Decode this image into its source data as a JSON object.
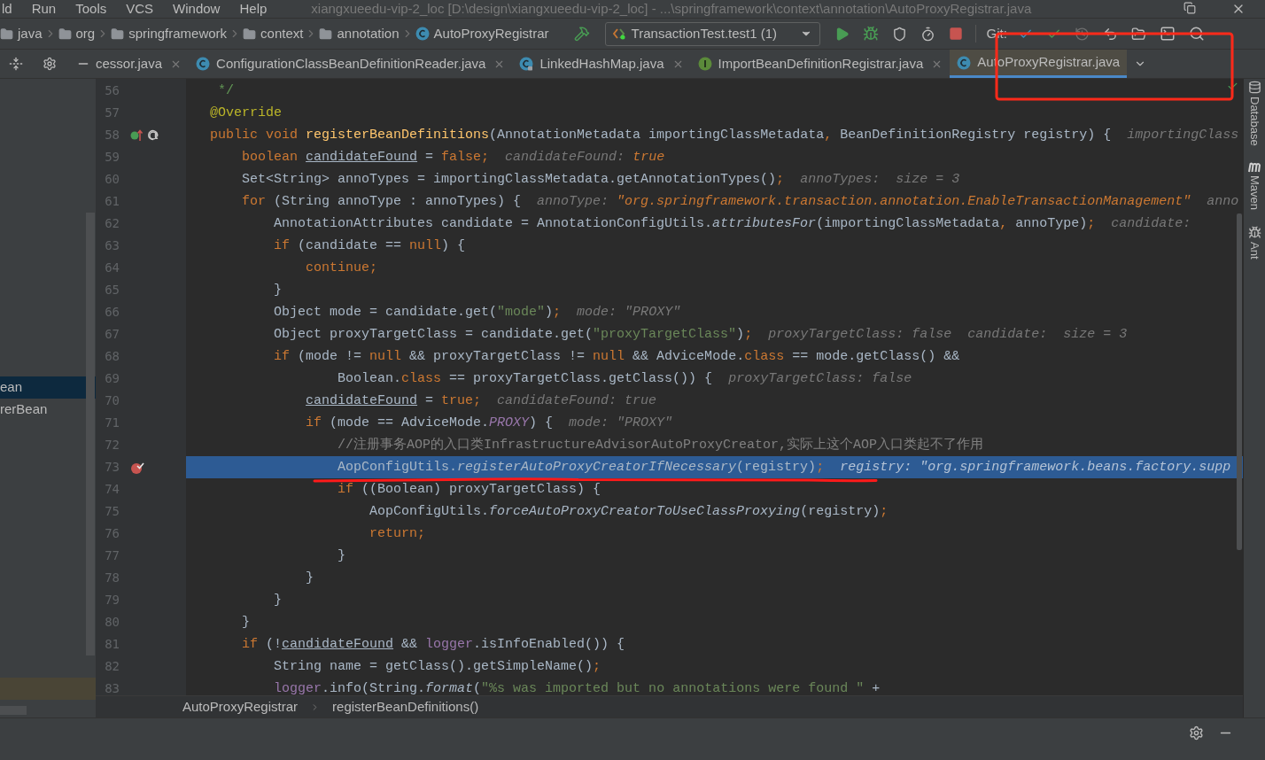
{
  "menu_bar": {
    "items": [
      "ld",
      "Run",
      "Tools",
      "VCS",
      "Window",
      "Help"
    ],
    "title": "xiangxueedu-vip-2_loc [D:\\design\\xiangxueedu-vip-2_loc] - ...\\springframework\\context\\annotation\\AutoProxyRegistrar.java"
  },
  "navigation_bar": {
    "breadcrumbs": [
      {
        "kind": "folder",
        "label": "java"
      },
      {
        "kind": "folder",
        "label": "org"
      },
      {
        "kind": "folder",
        "label": "springframework"
      },
      {
        "kind": "folder",
        "label": "context"
      },
      {
        "kind": "folder",
        "label": "annotation"
      },
      {
        "kind": "class",
        "label": "AutoProxyRegistrar"
      }
    ],
    "run_configuration": "TransactionTest.test1 (1)",
    "vcs_label": "Git:"
  },
  "project_panel": {
    "items": [
      {
        "label": "ean",
        "selected": true
      },
      {
        "label": "rerBean",
        "selected": false
      }
    ]
  },
  "tabs": [
    {
      "kind": "plain",
      "label": "cessor.java",
      "selected": false,
      "closable": true
    },
    {
      "kind": "class",
      "label": "ConfigurationClassBeanDefinitionReader.java",
      "selected": false,
      "closable": true
    },
    {
      "kind": "locked-class",
      "label": "LinkedHashMap.java",
      "selected": false,
      "closable": true
    },
    {
      "kind": "interface",
      "label": "ImportBeanDefinitionRegistrar.java",
      "selected": false,
      "closable": true
    },
    {
      "kind": "class",
      "label": "AutoProxyRegistrar.java",
      "selected": true,
      "closable": false
    }
  ],
  "editor": {
    "lines": [
      {
        "number": "56",
        "current": false,
        "tokens": [
          {
            "kind": "doc",
            "text": " */"
          }
        ]
      },
      {
        "number": "57",
        "current": false,
        "tokens": [
          {
            "kind": "annotation",
            "text": "@Override"
          }
        ]
      },
      {
        "number": "58",
        "current": false,
        "gutter_icons": [
          {
            "kind": "implements"
          }
        ],
        "tokens": [
          {
            "kind": "keyword",
            "text": "public void "
          },
          {
            "kind": "declaration",
            "text": "registerBeanDefinitions"
          },
          {
            "kind": "plain",
            "text": "(AnnotationMetadata importingClassMetadata"
          },
          {
            "kind": "keyword",
            "text": ","
          },
          {
            "kind": "plain",
            "text": " BeanDefinitionRegistry registry) {"
          },
          {
            "kind": "hint",
            "text": "  importingClass"
          }
        ]
      },
      {
        "number": "59",
        "current": false,
        "tokens": [
          {
            "kind": "keyword",
            "text": "    boolean "
          },
          {
            "kind": "underlined",
            "text": "candidateFound"
          },
          {
            "kind": "plain",
            "text": " = "
          },
          {
            "kind": "keyword",
            "text": "false;"
          },
          {
            "kind": "hint",
            "text": "  candidateFound: "
          },
          {
            "kind": "hint-value",
            "text": "true"
          }
        ]
      },
      {
        "number": "60",
        "current": false,
        "tokens": [
          {
            "kind": "plain",
            "text": "    Set<String> annoTypes = importingClassMetadata.getAnnotationTypes()"
          },
          {
            "kind": "keyword",
            "text": ";"
          },
          {
            "kind": "hint",
            "text": "  annoTypes:  size = 3"
          }
        ]
      },
      {
        "number": "61",
        "current": false,
        "tokens": [
          {
            "kind": "keyword",
            "text": "    for"
          },
          {
            "kind": "plain",
            "text": " (String annoType : annoTypes) {"
          },
          {
            "kind": "hint",
            "text": "  annoType: "
          },
          {
            "kind": "hint-value",
            "text": "\"org.springframework.transaction.annotation.EnableTransactionManagement\""
          },
          {
            "kind": "hint",
            "text": "  anno"
          }
        ]
      },
      {
        "number": "62",
        "current": false,
        "tokens": [
          {
            "kind": "plain",
            "text": "        AnnotationAttributes candidate = AnnotationConfigUtils."
          },
          {
            "kind": "italic",
            "text": "attributesFor"
          },
          {
            "kind": "plain",
            "text": "(importingClassMetadata"
          },
          {
            "kind": "keyword",
            "text": ","
          },
          {
            "kind": "plain",
            "text": " annoType)"
          },
          {
            "kind": "keyword",
            "text": ";"
          },
          {
            "kind": "hint",
            "text": "  candidate:"
          }
        ]
      },
      {
        "number": "63",
        "current": false,
        "tokens": [
          {
            "kind": "keyword",
            "text": "        if"
          },
          {
            "kind": "plain",
            "text": " (candidate == "
          },
          {
            "kind": "keyword",
            "text": "null"
          },
          {
            "kind": "plain",
            "text": ") {"
          }
        ]
      },
      {
        "number": "64",
        "current": false,
        "tokens": [
          {
            "kind": "keyword",
            "text": "            continue;"
          }
        ]
      },
      {
        "number": "65",
        "current": false,
        "tokens": [
          {
            "kind": "plain",
            "text": "        }"
          }
        ]
      },
      {
        "number": "66",
        "current": false,
        "tokens": [
          {
            "kind": "plain",
            "text": "        Object mode = candidate.get("
          },
          {
            "kind": "string",
            "text": "\"mode\""
          },
          {
            "kind": "plain",
            "text": ")"
          },
          {
            "kind": "keyword",
            "text": ";"
          },
          {
            "kind": "hint",
            "text": "  mode: \"PROXY\""
          }
        ]
      },
      {
        "number": "67",
        "current": false,
        "tokens": [
          {
            "kind": "plain",
            "text": "        Object proxyTargetClass = candidate.get("
          },
          {
            "kind": "string",
            "text": "\"proxyTargetClass\""
          },
          {
            "kind": "plain",
            "text": ")"
          },
          {
            "kind": "keyword",
            "text": ";"
          },
          {
            "kind": "hint",
            "text": "  proxyTargetClass: false  candidate:  size = 3"
          }
        ]
      },
      {
        "number": "68",
        "current": false,
        "tokens": [
          {
            "kind": "keyword",
            "text": "        if"
          },
          {
            "kind": "plain",
            "text": " (mode != "
          },
          {
            "kind": "keyword",
            "text": "null"
          },
          {
            "kind": "plain",
            "text": " && proxyTargetClass != "
          },
          {
            "kind": "keyword",
            "text": "null"
          },
          {
            "kind": "plain",
            "text": " && AdviceMode."
          },
          {
            "kind": "keyword",
            "text": "class"
          },
          {
            "kind": "plain",
            "text": " == mode.getClass() &&"
          }
        ]
      },
      {
        "number": "69",
        "current": false,
        "tokens": [
          {
            "kind": "plain",
            "text": "                Boolean."
          },
          {
            "kind": "keyword",
            "text": "class"
          },
          {
            "kind": "plain",
            "text": " == proxyTargetClass.getClass()) {"
          },
          {
            "kind": "hint",
            "text": "  proxyTargetClass: false"
          }
        ]
      },
      {
        "number": "70",
        "current": false,
        "tokens": [
          {
            "kind": "underlined",
            "text": "            candidateFound"
          },
          {
            "kind": "plain",
            "text": " = "
          },
          {
            "kind": "keyword",
            "text": "true;"
          },
          {
            "kind": "hint",
            "text": "  candidateFound: true"
          }
        ]
      },
      {
        "number": "71",
        "current": false,
        "tokens": [
          {
            "kind": "keyword",
            "text": "            if"
          },
          {
            "kind": "plain",
            "text": " (mode == AdviceMode."
          },
          {
            "kind": "constant",
            "text": "PROXY"
          },
          {
            "kind": "plain",
            "text": ") {"
          },
          {
            "kind": "hint",
            "text": "  mode: \"PROXY\""
          }
        ]
      },
      {
        "number": "72",
        "current": false,
        "tokens": [
          {
            "kind": "comment",
            "text": "                //注册事务AOP的入口类InfrastructureAdvisorAutoProxyCreator,实际上这个AOP入口类起不了作用"
          }
        ]
      },
      {
        "number": "73",
        "current": true,
        "gutter_icons": [
          {
            "kind": "breakpoint"
          }
        ],
        "tokens": [
          {
            "kind": "plain",
            "text": "                AopConfigUtils."
          },
          {
            "kind": "italic",
            "text": "registerAutoProxyCreatorIfNecessary"
          },
          {
            "kind": "plain",
            "text": "(registry)"
          },
          {
            "kind": "keyword",
            "text": ";"
          },
          {
            "kind": "hint",
            "text": "  registry: \"org.springframework.beans.factory.supp"
          }
        ]
      },
      {
        "number": "74",
        "current": false,
        "tokens": [
          {
            "kind": "keyword",
            "text": "                if"
          },
          {
            "kind": "plain",
            "text": " ((Boolean) proxyTargetClass) {"
          }
        ]
      },
      {
        "number": "75",
        "current": false,
        "tokens": [
          {
            "kind": "plain",
            "text": "                    AopConfigUtils."
          },
          {
            "kind": "italic",
            "text": "forceAutoProxyCreatorToUseClassProxying"
          },
          {
            "kind": "plain",
            "text": "(registry)"
          },
          {
            "kind": "keyword",
            "text": ";"
          }
        ]
      },
      {
        "number": "76",
        "current": false,
        "tokens": [
          {
            "kind": "keyword",
            "text": "                    return;"
          }
        ]
      },
      {
        "number": "77",
        "current": false,
        "tokens": [
          {
            "kind": "plain",
            "text": "                }"
          }
        ]
      },
      {
        "number": "78",
        "current": false,
        "tokens": [
          {
            "kind": "plain",
            "text": "            }"
          }
        ]
      },
      {
        "number": "79",
        "current": false,
        "tokens": [
          {
            "kind": "plain",
            "text": "        }"
          }
        ]
      },
      {
        "number": "80",
        "current": false,
        "tokens": [
          {
            "kind": "plain",
            "text": "    }"
          }
        ]
      },
      {
        "number": "81",
        "current": false,
        "tokens": [
          {
            "kind": "keyword",
            "text": "    if"
          },
          {
            "kind": "plain",
            "text": " (!"
          },
          {
            "kind": "underlined",
            "text": "candidateFound"
          },
          {
            "kind": "plain",
            "text": " && "
          },
          {
            "kind": "field",
            "text": "logger"
          },
          {
            "kind": "plain",
            "text": ".isInfoEnabled()) {"
          }
        ]
      },
      {
        "number": "82",
        "current": false,
        "tokens": [
          {
            "kind": "plain",
            "text": "        String name = getClass().getSimpleName()"
          },
          {
            "kind": "keyword",
            "text": ";"
          }
        ]
      },
      {
        "number": "83",
        "current": false,
        "tokens": [
          {
            "kind": "field",
            "text": "        logger"
          },
          {
            "kind": "plain",
            "text": ".info(String."
          },
          {
            "kind": "italic",
            "text": "format"
          },
          {
            "kind": "plain",
            "text": "("
          },
          {
            "kind": "string",
            "text": "\"%s was imported but no annotations were found \""
          },
          {
            "kind": "plain",
            "text": " +"
          }
        ]
      }
    ]
  },
  "editor_breadcrumbs": [
    "AutoProxyRegistrar",
    "registerBeanDefinitions()"
  ],
  "tool_window_stripe": [
    {
      "kind": "database",
      "label": "Database"
    },
    {
      "kind": "maven",
      "label": "Maven"
    },
    {
      "kind": "ant",
      "label": "Ant"
    }
  ]
}
